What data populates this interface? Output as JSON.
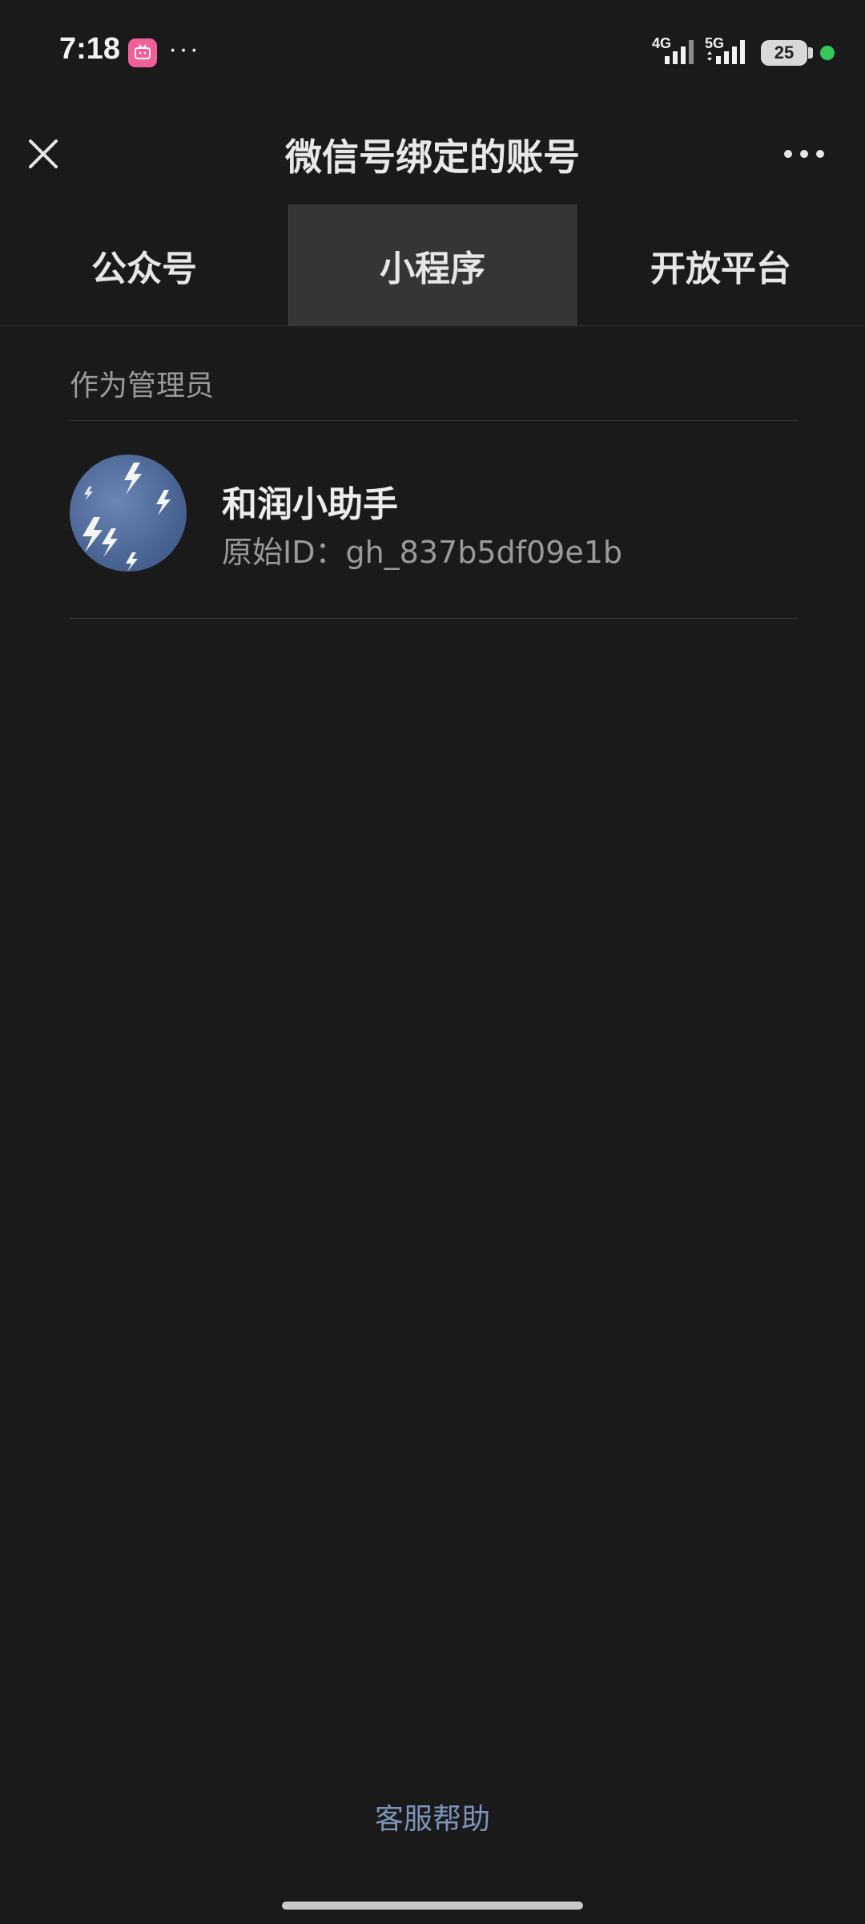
{
  "status_bar": {
    "time": "7:18",
    "more": "···",
    "network_1": "4G",
    "network_2": "5G",
    "battery": "25"
  },
  "nav": {
    "title": "微信号绑定的账号"
  },
  "tabs": [
    {
      "label": "公众号",
      "active": false
    },
    {
      "label": "小程序",
      "active": true
    },
    {
      "label": "开放平台",
      "active": false
    }
  ],
  "section": {
    "title": "作为管理员"
  },
  "accounts": [
    {
      "name": "和润小助手",
      "original_id": "原始ID：gh_837b5df09e1b"
    }
  ],
  "footer": {
    "help": "客服帮助"
  },
  "colors": {
    "background": "#1a1a1a",
    "active_tab": "#353535",
    "link": "#7d93b8",
    "status_dot": "#35c759",
    "app_icon": "#ef5f9a"
  }
}
